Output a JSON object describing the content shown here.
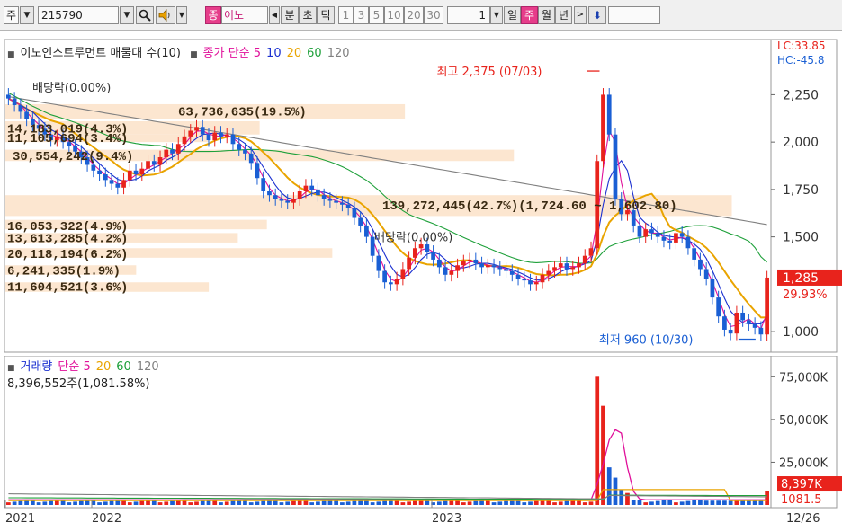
{
  "toolbar": {
    "market_label": "주",
    "code": "215790",
    "name_tag": "종",
    "name_text": "이노",
    "period_labels": [
      "분",
      "초",
      "틱"
    ],
    "intervals": [
      "1",
      "3",
      "5",
      "10",
      "20",
      "30"
    ],
    "count": "1",
    "period_buttons": [
      "일",
      "주",
      "월",
      "년"
    ],
    "active_period": "주"
  },
  "price_legend": {
    "title": "이노인스트루먼트 매물대 수(10)",
    "ma_label": "종가 단순 5",
    "periods": [
      "10",
      "20",
      "60",
      "120"
    ]
  },
  "volume_legend": {
    "title": "거래량",
    "ma_label": "단순 5",
    "periods": [
      "20",
      "60",
      "120"
    ],
    "volume_text": "8,396,552주(1,081.58%)"
  },
  "colors": {
    "up": "#e8231c",
    "down": "#1a5fd4",
    "ma5": "#e0109a",
    "ma10": "#1a2fd0",
    "ma20": "#e9a400",
    "ma60": "#1ea03a",
    "ma120": "#808080",
    "profile_fill": "#fbe2c8",
    "accent": "#e63d8a"
  },
  "chart_data": [
    {
      "type": "candlestick",
      "title": "이노인스트루먼트 매물대 수(10)",
      "interval": "주",
      "price_axis_ticks": [
        "2,250",
        "2,000",
        "1,750",
        "1,500",
        "1,000"
      ],
      "price_axis_values": [
        2250,
        2000,
        1750,
        1500,
        1000
      ],
      "ylim": [
        915,
        2380
      ],
      "x_ticks": [
        "2021",
        "2022",
        "2023",
        "12/26"
      ],
      "current_price": 1285,
      "current_price_label": "1,285",
      "change_label": "29.93%",
      "lc_label": "LC:33.85",
      "hc_label": "HC:-45.8",
      "high_annotation": "최고 2,375 (07/03)",
      "high": 2375,
      "low_annotation": "최저 960 (10/30)",
      "low": 960,
      "dividend_labels": [
        "배당락(0.00%)",
        "배당락(0.00%)"
      ],
      "volume_profile": [
        {
          "label": "14,183,019(4.3%)"
        },
        {
          "label": "11,105,694(3.4%)"
        },
        {
          "label": "30,554,242(9.4%)"
        },
        {
          "label": "139,272,445(42.7%)(1,724.60 ~ 1,602.80)"
        },
        {
          "label": "16,053,322(4.9%)"
        },
        {
          "label": "13,613,285(4.2%)"
        },
        {
          "label": "20,118,194(6.2%)"
        },
        {
          "label": "6,241,335(1.9%)"
        },
        {
          "label": "11,604,521(3.6%)"
        },
        {
          "label": "63,736,635(19.5%)"
        }
      ],
      "close": [
        2230,
        2195,
        2160,
        2120,
        2090,
        2070,
        2040,
        2010,
        2030,
        2000,
        1980,
        1950,
        1920,
        1880,
        1850,
        1830,
        1800,
        1780,
        1760,
        1800,
        1850,
        1830,
        1860,
        1900,
        1880,
        1920,
        1960,
        1940,
        1990,
        2030,
        2060,
        2080,
        2040,
        2010,
        2050,
        2030,
        2040,
        1990,
        1960,
        1940,
        1890,
        1810,
        1740,
        1720,
        1700,
        1690,
        1680,
        1700,
        1740,
        1770,
        1750,
        1720,
        1700,
        1690,
        1680,
        1670,
        1650,
        1600,
        1560,
        1500,
        1400,
        1320,
        1260,
        1250,
        1280,
        1330,
        1390,
        1440,
        1460,
        1420,
        1380,
        1340,
        1300,
        1320,
        1350,
        1370,
        1380,
        1360,
        1340,
        1350,
        1340,
        1330,
        1320,
        1300,
        1280,
        1270,
        1250,
        1260,
        1300,
        1320,
        1340,
        1360,
        1330,
        1340,
        1360,
        1400,
        1440,
        1900,
        2250,
        2040,
        1700,
        1620,
        1640,
        1560,
        1500,
        1540,
        1520,
        1500,
        1480,
        1470,
        1520,
        1500,
        1440,
        1380,
        1330,
        1280,
        1180,
        1080,
        1010,
        990,
        1100,
        1060,
        1040,
        1020,
        985,
        1285
      ],
      "volume_ma": [
        20,
        60,
        120
      ]
    },
    {
      "type": "bar",
      "title": "거래량",
      "y_axis_ticks": [
        "75,000K",
        "50,000K",
        "25,000K"
      ],
      "y_axis_values": [
        75000,
        50000,
        25000
      ],
      "ylim": [
        0,
        82000
      ],
      "last_volume_label": "8,397K",
      "ratio_label": "1081.5",
      "unit": "K",
      "peak_volumes": [
        {
          "position": "2023-07",
          "value": 75000
        },
        {
          "position": "2023-07",
          "value": 58000
        },
        {
          "position": "2023-08",
          "value": 22000
        }
      ]
    }
  ]
}
